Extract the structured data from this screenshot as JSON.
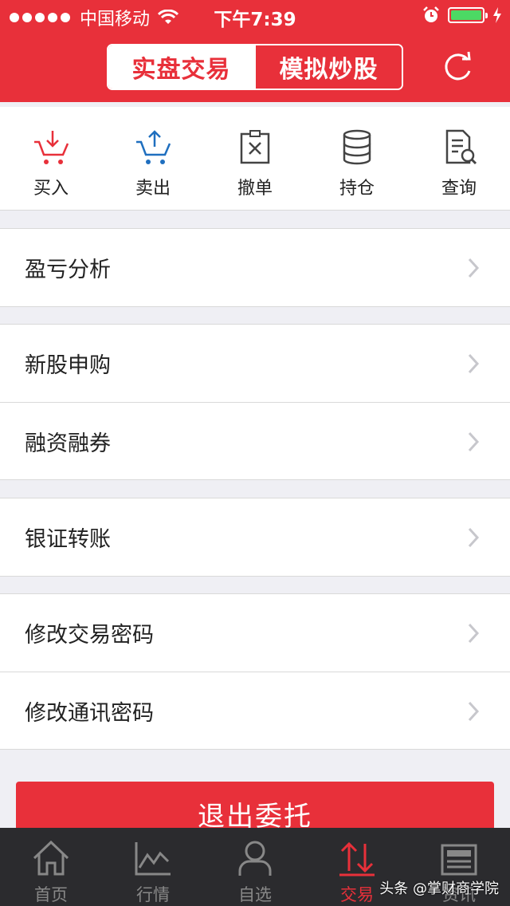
{
  "status_bar": {
    "carrier": "中国移动",
    "time": "下午7:39"
  },
  "header": {
    "tabs": [
      {
        "label": "实盘交易",
        "active": true
      },
      {
        "label": "模拟炒股",
        "active": false
      }
    ]
  },
  "quick_actions": [
    {
      "label": "买入",
      "icon": "cart-down-icon"
    },
    {
      "label": "卖出",
      "icon": "cart-up-icon"
    },
    {
      "label": "撤单",
      "icon": "cancel-order-icon"
    },
    {
      "label": "持仓",
      "icon": "database-icon"
    },
    {
      "label": "查询",
      "icon": "document-search-icon"
    }
  ],
  "menu_groups": [
    [
      "盈亏分析"
    ],
    [
      "新股申购",
      "融资融券"
    ],
    [
      "银证转账"
    ],
    [
      "修改交易密码",
      "修改通讯密码"
    ]
  ],
  "exit_button": "退出委托",
  "tab_bar": [
    {
      "label": "首页",
      "icon": "home-icon",
      "active": false
    },
    {
      "label": "行情",
      "icon": "chart-line-icon",
      "active": false
    },
    {
      "label": "自选",
      "icon": "user-icon",
      "active": false
    },
    {
      "label": "交易",
      "icon": "trade-arrows-icon",
      "active": true
    },
    {
      "label": "资讯",
      "icon": "news-icon",
      "active": false
    }
  ],
  "watermark": "头条 @掌财商学院",
  "colors": {
    "primary_red": "#e8303a",
    "tabbar_bg": "#2b2b2e",
    "battery_green": "#4cd964",
    "buy_icon": "#e8303a",
    "sell_icon": "#1f6fbf"
  }
}
